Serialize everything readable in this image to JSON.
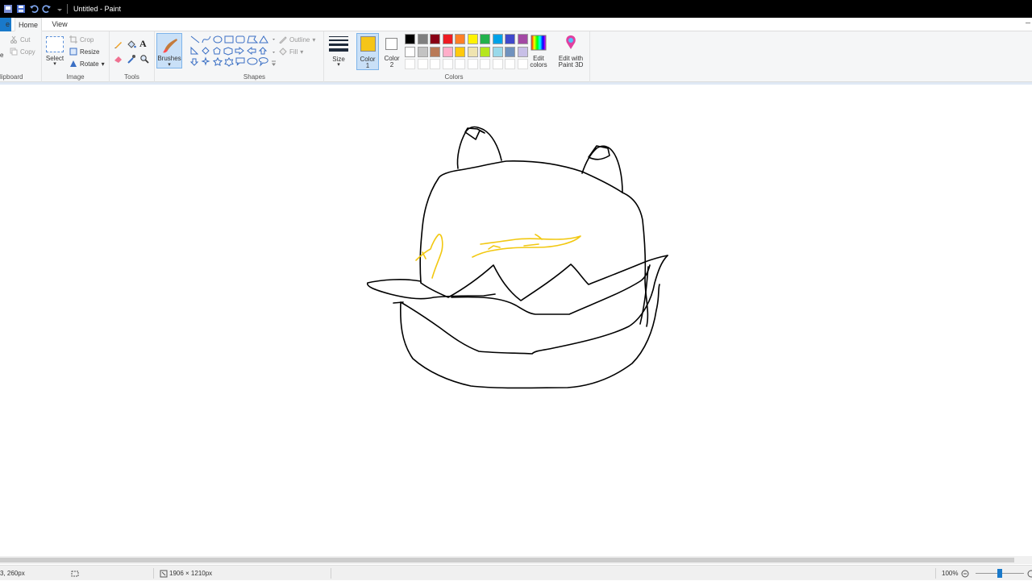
{
  "window": {
    "title": "Untitled - Paint"
  },
  "tabs": {
    "file": "e",
    "home": "Home",
    "view": "View"
  },
  "clipboard": {
    "paste_fragment": "e",
    "cut": "Cut",
    "copy": "Copy",
    "label": "lipboard"
  },
  "image": {
    "select": "Select",
    "crop": "Crop",
    "resize": "Resize",
    "rotate": "Rotate",
    "label": "Image"
  },
  "tools": {
    "label": "Tools",
    "text_glyph": "A"
  },
  "brushes": {
    "label": "Brushes"
  },
  "shapes": {
    "outline": "Outline",
    "fill": "Fill",
    "label": "Shapes"
  },
  "size": {
    "label": "Size"
  },
  "colors": {
    "color1_label_a": "Color",
    "color1_label_b": "1",
    "color2_label_a": "Color",
    "color2_label_b": "2",
    "edit_colors_a": "Edit",
    "edit_colors_b": "colors",
    "paint3d_a": "Edit with",
    "paint3d_b": "Paint 3D",
    "label": "Colors",
    "color1_value": "#f5c518",
    "color2_value": "#ffffff",
    "palette_row1": [
      "#000000",
      "#7f7f7f",
      "#880015",
      "#ed1c24",
      "#ff7f27",
      "#fff200",
      "#22b14c",
      "#00a2e8",
      "#3f48cc",
      "#a349a4"
    ],
    "palette_row2": [
      "#ffffff",
      "#c3c3c3",
      "#b97a57",
      "#ffaec9",
      "#ffc90e",
      "#efe4b0",
      "#b5e61d",
      "#99d9ea",
      "#7092be",
      "#c8bfe7"
    ]
  },
  "status": {
    "cursor": "3, 260px",
    "dimensions": "1906 × 1210px",
    "zoom": "100%"
  },
  "drawing": {
    "stroke_black": "#000000",
    "stroke_yellow": "#f2c811"
  }
}
